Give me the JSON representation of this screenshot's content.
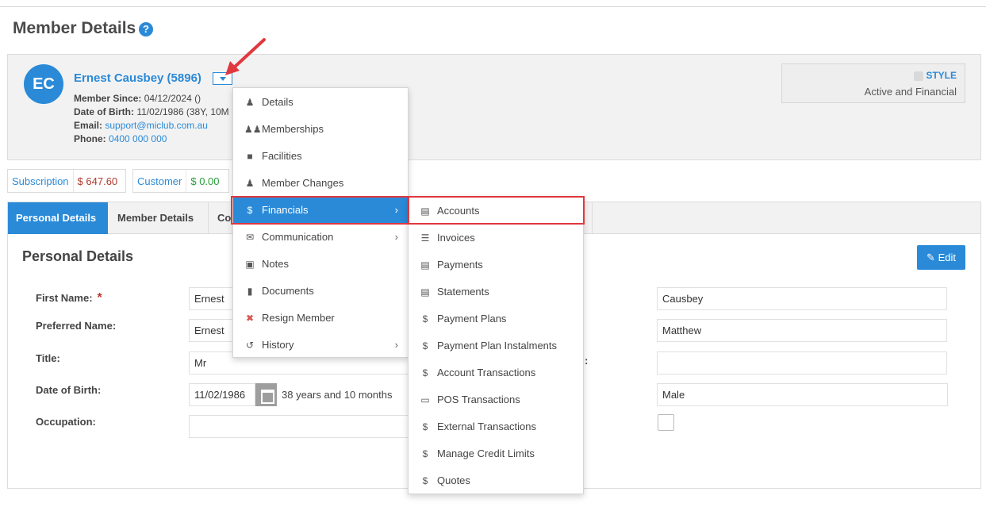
{
  "page": {
    "title": "Member Details",
    "help_icon": "question-circle-icon"
  },
  "member": {
    "initials": "EC",
    "name": "Ernest Causbey (5896)",
    "member_since_label": "Member Since:",
    "member_since": "04/12/2024 ()",
    "dob_label": "Date of Birth:",
    "dob": "11/02/1986 (38Y, 10M",
    "email_label": "Email:",
    "email": "support@miclub.com.au",
    "phone_label": "Phone:",
    "phone": "0400 000 000"
  },
  "style_box": {
    "label": "STYLE",
    "status": "Active and Financial"
  },
  "balances": [
    {
      "label": "Subscription",
      "value": "$ 647.60"
    },
    {
      "label": "Customer",
      "value": "$ 0.00"
    }
  ],
  "tabs": [
    {
      "label": "Personal Details"
    },
    {
      "label": "Member Details"
    },
    {
      "label": "Co"
    }
  ],
  "section": {
    "title": "Personal Details",
    "edit_label": "Edit",
    "fields": {
      "first_name_label": "First Name:",
      "first_name_value": "Ernest",
      "preferred_name_label": "Preferred Name:",
      "preferred_name_value": "Ernest",
      "title_label": "Title:",
      "title_value": "Mr",
      "dob_label": "Date of Birth:",
      "dob_value": "11/02/1986",
      "age_text": "38 years and 10 months",
      "occupation_label": "Occupation:",
      "occupation_value": "",
      "surname_value": "Causbey",
      "other_name_value": "Matthew",
      "right_blank_value": "",
      "gender_value": "Male",
      "side_colon": ":"
    }
  },
  "menu_main": [
    {
      "label": "Details",
      "icon": "user-icon",
      "has_sub": false
    },
    {
      "label": "Memberships",
      "icon": "users-icon",
      "has_sub": false
    },
    {
      "label": "Facilities",
      "icon": "puzzle-icon",
      "has_sub": false
    },
    {
      "label": "Member Changes",
      "icon": "user-icon",
      "has_sub": false
    },
    {
      "label": "Financials",
      "icon": "dollar-icon",
      "has_sub": true,
      "active": true
    },
    {
      "label": "Communication",
      "icon": "envelope-icon",
      "has_sub": true
    },
    {
      "label": "Notes",
      "icon": "archive-icon",
      "has_sub": false
    },
    {
      "label": "Documents",
      "icon": "file-icon",
      "has_sub": false
    },
    {
      "label": "Resign Member",
      "icon": "times-circle-icon",
      "has_sub": false
    },
    {
      "label": "History",
      "icon": "history-icon",
      "has_sub": true
    }
  ],
  "menu_sub": [
    {
      "label": "Accounts",
      "icon": "bar-chart-icon"
    },
    {
      "label": "Invoices",
      "icon": "list-icon"
    },
    {
      "label": "Payments",
      "icon": "file-text-icon"
    },
    {
      "label": "Statements",
      "icon": "file-text-icon"
    },
    {
      "label": "Payment Plans",
      "icon": "dollar-icon"
    },
    {
      "label": "Payment Plan Instalments",
      "icon": "dollar-icon"
    },
    {
      "label": "Account Transactions",
      "icon": "dollar-icon"
    },
    {
      "label": "POS Transactions",
      "icon": "monitor-icon"
    },
    {
      "label": "External Transactions",
      "icon": "dollar-icon"
    },
    {
      "label": "Manage Credit Limits",
      "icon": "dollar-icon"
    },
    {
      "label": "Quotes",
      "icon": "dollar-icon"
    }
  ],
  "colors": {
    "accent": "#2a8ad8",
    "annotation_red": "#e0383e",
    "negative": "#b03a2e",
    "positive": "#2a9d3a"
  }
}
